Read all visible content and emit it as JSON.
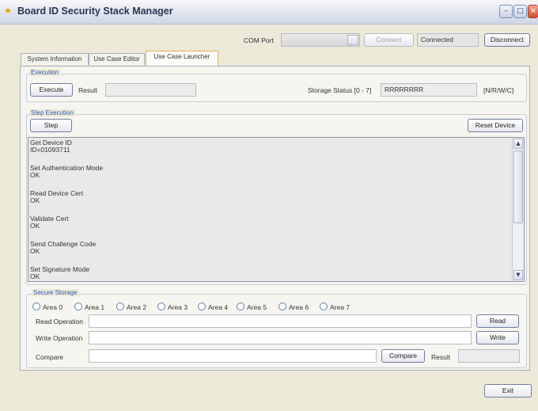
{
  "window": {
    "title": "Board ID Security Stack Manager",
    "icon": "app-icon"
  },
  "header": {
    "com_port_label": "COM Port",
    "com_port_value": "",
    "connect_label": "Connect",
    "connection_status": "Connected",
    "disconnect_label": "Disconnect"
  },
  "tabs": [
    {
      "label": "System Information",
      "active": false
    },
    {
      "label": "Use Case Editor",
      "active": false
    },
    {
      "label": "Use Case Launcher",
      "active": true
    }
  ],
  "execution": {
    "title": "Execution",
    "execute_label": "Execute",
    "result_label": "Result",
    "result_value": "",
    "storage_status_label": "Storage Status [0 - 7]",
    "storage_status_value": "RRRRRRRR",
    "legend": "[N/R/W/C]"
  },
  "step_execution": {
    "title": "Step Execution",
    "step_label": "Step",
    "reset_label": "Reset Device",
    "log": [
      {
        "line1": "Get Device ID",
        "line2": "ID=01093711"
      },
      {
        "line1": "Set Authentication Mode",
        "line2": "OK"
      },
      {
        "line1": "Read Device Cert",
        "line2": "OK"
      },
      {
        "line1": "Validate Cert",
        "line2": "OK"
      },
      {
        "line1": "Send Challenge Code",
        "line2": "OK"
      },
      {
        "line1": "Set Signature Mode",
        "line2": "OK"
      }
    ]
  },
  "secure_storage": {
    "title": "Secure Storage",
    "areas": [
      "Area 0",
      "Area 1",
      "Area 2",
      "Area 3",
      "Area 4",
      "Area 5",
      "Area 6",
      "Area 7"
    ],
    "read_operation_label": "Read Operation",
    "read_label": "Read",
    "write_operation_label": "Write Operation",
    "write_label": "Write",
    "compare_label": "Compare",
    "compare_button_label": "Compare",
    "result_label": "Result",
    "result_value": ""
  },
  "footer": {
    "exit_label": "Exit"
  }
}
